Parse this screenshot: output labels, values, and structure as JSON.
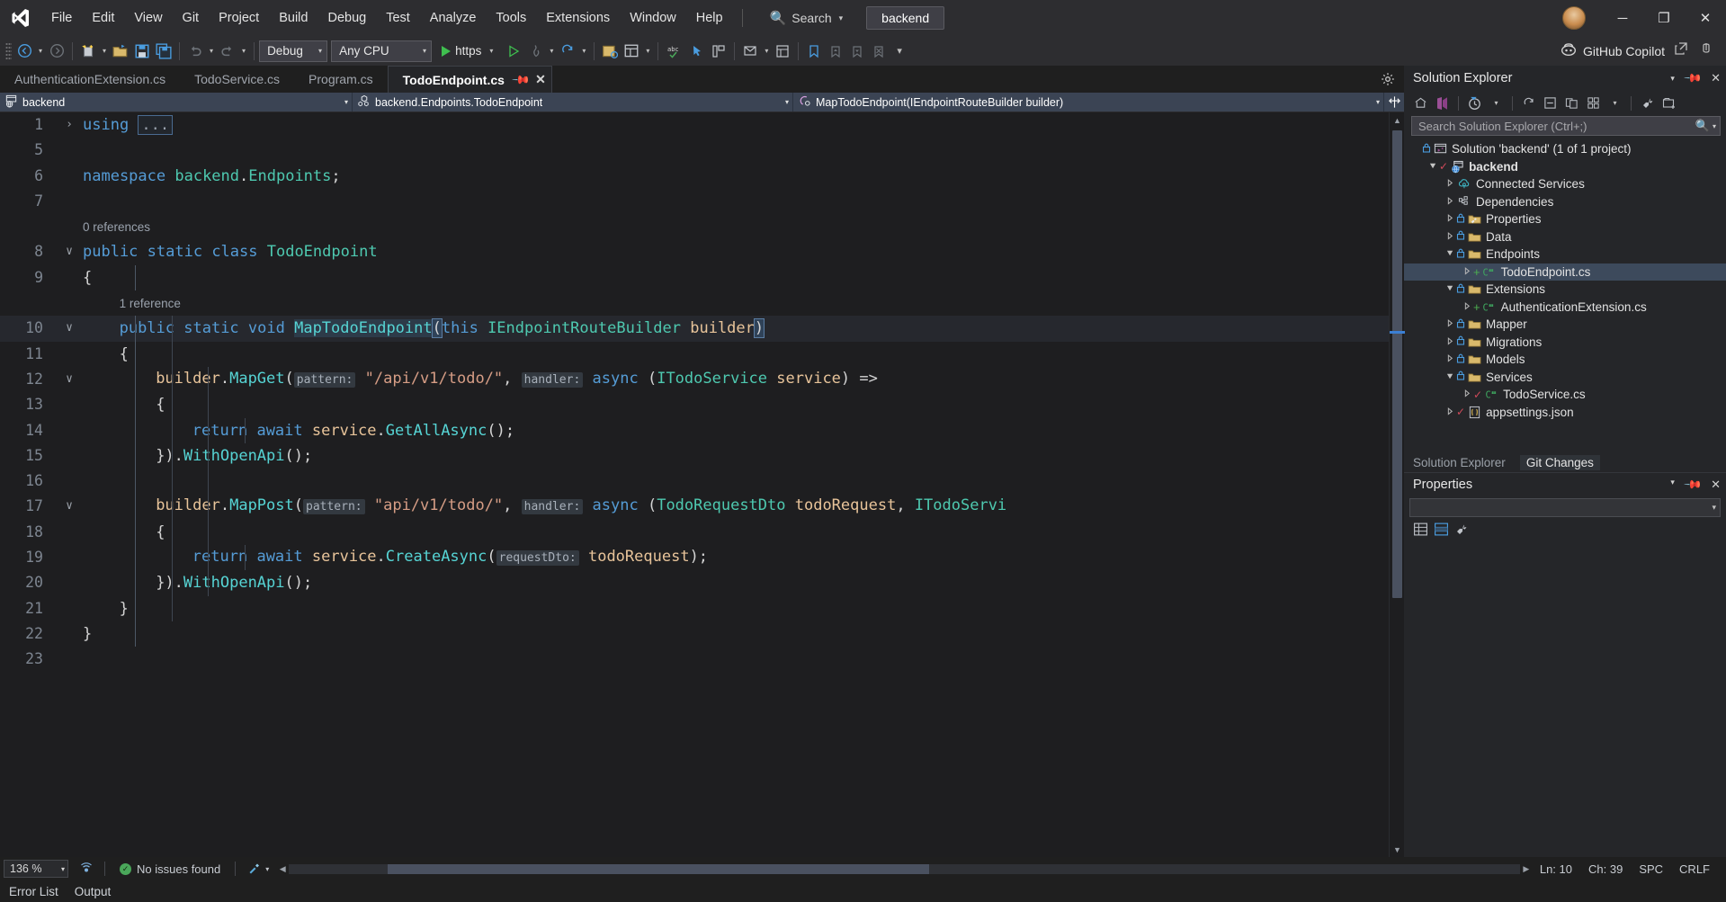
{
  "titlebar": {
    "logo_icon": "visual-studio-logo",
    "menus": [
      "File",
      "Edit",
      "View",
      "Git",
      "Project",
      "Build",
      "Debug",
      "Test",
      "Analyze",
      "Tools",
      "Extensions",
      "Window",
      "Help"
    ],
    "search": {
      "label": "Search",
      "icon": "search-icon",
      "caret": "▾"
    },
    "solution_name": "backend",
    "avatar_icon": "user-avatar",
    "window_buttons": {
      "minimize": "─",
      "maximize": "❐",
      "close": "✕"
    }
  },
  "toolbar": {
    "nav_back_icon": "navigate-back-icon",
    "nav_fwd_icon": "navigate-forward-icon",
    "new_project_icon": "new-project-icon",
    "open_folder_icon": "open-folder-icon",
    "save_icon": "save-icon",
    "save_all_icon": "save-all-icon",
    "undo_icon": "undo-icon",
    "redo_icon": "redo-icon",
    "config_value": "Debug",
    "platform_value": "Any CPU",
    "run_label": "https",
    "run_icon": "start-debug-icon",
    "run_nodebug_icon": "start-without-debugging-icon",
    "hot_reload_icon": "hot-reload-icon",
    "restart_icon": "restart-icon",
    "solution_explorer_icon": "solution-explorer-icon",
    "properties_window_icon": "properties-window-icon",
    "spell_check_icon": "spell-check-icon",
    "pointer_icon": "select-element-icon",
    "layout_icon": "layout-icon",
    "toolbox_icon": "toolbox-icon",
    "notifications_icon": "notifications-icon",
    "bookmark_icon": "bookmark-icon",
    "bookmark_prev_icon": "bookmark-prev-icon",
    "bookmark_next_icon": "bookmark-next-icon",
    "bookmark_clear_icon": "bookmark-clear-icon",
    "overflow_icon": "toolbar-overflow-icon",
    "copilot_label": "GitHub Copilot",
    "copilot_icon": "github-copilot-icon",
    "share_icon": "share-icon",
    "feedback_icon": "feedback-icon"
  },
  "tabs": [
    {
      "label": "AuthenticationExtension.cs",
      "active": false
    },
    {
      "label": "TodoService.cs",
      "active": false
    },
    {
      "label": "Program.cs",
      "active": false
    },
    {
      "label": "TodoEndpoint.cs",
      "active": true,
      "pin_icon": "pin-icon",
      "close_icon": "close-icon"
    }
  ],
  "tabstrip_actions": {
    "dropdown_icon": "tab-list-dropdown-icon",
    "settings_icon": "gear-icon"
  },
  "breadcrumb": {
    "project": "backend",
    "project_icon": "project-web-icon",
    "type": "backend.Endpoints.TodoEndpoint",
    "type_icon": "class-icon",
    "member": "MapTodoEndpoint(IEndpointRouteBuilder builder)",
    "member_icon": "method-icon",
    "split_icon": "split-view-icon",
    "caret": "▾"
  },
  "editor": {
    "lines": [
      {
        "num": "1",
        "glyph": "›",
        "highlight": false,
        "indent": 0,
        "tokens": [
          {
            "t": "using ",
            "c": "k"
          },
          {
            "t": "...",
            "c": "collapse"
          }
        ]
      },
      {
        "num": "5",
        "glyph": "",
        "highlight": false,
        "indent": 0,
        "tokens": []
      },
      {
        "num": "6",
        "glyph": "",
        "highlight": false,
        "indent": 0,
        "tokens": [
          {
            "t": "namespace ",
            "c": "k"
          },
          {
            "t": "backend",
            "c": "kc"
          },
          {
            "t": ".",
            "c": "pn"
          },
          {
            "t": "Endpoints",
            "c": "kc"
          },
          {
            "t": ";",
            "c": "pn"
          }
        ]
      },
      {
        "num": "7",
        "glyph": "",
        "highlight": false,
        "indent": 0,
        "tokens": []
      },
      {
        "ref": "0 references"
      },
      {
        "num": "8",
        "glyph": "∨",
        "highlight": false,
        "indent": 0,
        "tokens": [
          {
            "t": "public ",
            "c": "k"
          },
          {
            "t": "static ",
            "c": "k"
          },
          {
            "t": "class ",
            "c": "k"
          },
          {
            "t": "TodoEndpoint",
            "c": "kc"
          }
        ]
      },
      {
        "num": "9",
        "glyph": "",
        "highlight": false,
        "indent": 0,
        "guides": 1,
        "tokens": [
          {
            "t": "{",
            "c": "pn"
          }
        ]
      },
      {
        "ref": "1 reference",
        "guides": 1,
        "refindent": 1
      },
      {
        "num": "10",
        "glyph": "∨",
        "highlight": true,
        "indent": 1,
        "guides": 2,
        "tokens": [
          {
            "t": "public ",
            "c": "k"
          },
          {
            "t": "static ",
            "c": "k"
          },
          {
            "t": "void ",
            "c": "k"
          },
          {
            "t": "MapTodoEndpoint",
            "c": "selword-mth"
          },
          {
            "t": "(",
            "c": "braceblue"
          },
          {
            "t": "this ",
            "c": "k"
          },
          {
            "t": "IEndpointRouteBuilder ",
            "c": "kc"
          },
          {
            "t": "builder",
            "c": "par"
          },
          {
            "t": ")",
            "c": "braceblue"
          }
        ]
      },
      {
        "num": "11",
        "glyph": "",
        "highlight": false,
        "indent": 1,
        "guides": 2,
        "tokens": [
          {
            "t": "{",
            "c": "pn"
          }
        ]
      },
      {
        "num": "12",
        "glyph": "∨",
        "highlight": false,
        "indent": 2,
        "guides": 3,
        "tokens": [
          {
            "t": "builder",
            "c": "par"
          },
          {
            "t": ".",
            "c": "pn"
          },
          {
            "t": "MapGet",
            "c": "mth"
          },
          {
            "t": "(",
            "c": "pn"
          },
          {
            "t": "pattern:",
            "c": "hint"
          },
          {
            "t": " ",
            "c": "pn"
          },
          {
            "t": "\"/api/v1/todo/\"",
            "c": "str"
          },
          {
            "t": ", ",
            "c": "pn"
          },
          {
            "t": "handler:",
            "c": "hint"
          },
          {
            "t": " ",
            "c": "pn"
          },
          {
            "t": "async ",
            "c": "k"
          },
          {
            "t": "(",
            "c": "pn"
          },
          {
            "t": "ITodoService ",
            "c": "kc"
          },
          {
            "t": "service",
            "c": "par"
          },
          {
            "t": ") =>",
            "c": "pn"
          }
        ]
      },
      {
        "num": "13",
        "glyph": "",
        "highlight": false,
        "indent": 2,
        "guides": 3,
        "tokens": [
          {
            "t": "{",
            "c": "pn"
          }
        ]
      },
      {
        "num": "14",
        "glyph": "",
        "highlight": false,
        "indent": 3,
        "guides": 4,
        "tokens": [
          {
            "t": "return ",
            "c": "k"
          },
          {
            "t": "await ",
            "c": "k"
          },
          {
            "t": "service",
            "c": "par"
          },
          {
            "t": ".",
            "c": "pn"
          },
          {
            "t": "GetAllAsync",
            "c": "mth"
          },
          {
            "t": "();",
            "c": "pn"
          }
        ]
      },
      {
        "num": "15",
        "glyph": "",
        "highlight": false,
        "indent": 2,
        "guides": 3,
        "tokens": [
          {
            "t": "})",
            "c": "pn"
          },
          {
            "t": ".",
            "c": "pn"
          },
          {
            "t": "WithOpenApi",
            "c": "mth"
          },
          {
            "t": "();",
            "c": "pn"
          }
        ]
      },
      {
        "num": "16",
        "glyph": "",
        "highlight": false,
        "indent": 2,
        "guides": 3,
        "tokens": []
      },
      {
        "num": "17",
        "glyph": "∨",
        "highlight": false,
        "indent": 2,
        "guides": 3,
        "tokens": [
          {
            "t": "builder",
            "c": "par"
          },
          {
            "t": ".",
            "c": "pn"
          },
          {
            "t": "MapPost",
            "c": "mth"
          },
          {
            "t": "(",
            "c": "pn"
          },
          {
            "t": "pattern:",
            "c": "hint"
          },
          {
            "t": " ",
            "c": "pn"
          },
          {
            "t": "\"api/v1/todo/\"",
            "c": "str"
          },
          {
            "t": ", ",
            "c": "pn"
          },
          {
            "t": "handler:",
            "c": "hint"
          },
          {
            "t": " ",
            "c": "pn"
          },
          {
            "t": "async ",
            "c": "k"
          },
          {
            "t": "(",
            "c": "pn"
          },
          {
            "t": "TodoRequestDto ",
            "c": "kc"
          },
          {
            "t": "todoRequest",
            "c": "par"
          },
          {
            "t": ", ",
            "c": "pn"
          },
          {
            "t": "ITodoServi",
            "c": "kc"
          }
        ]
      },
      {
        "num": "18",
        "glyph": "",
        "highlight": false,
        "indent": 2,
        "guides": 3,
        "tokens": [
          {
            "t": "{",
            "c": "pn"
          }
        ]
      },
      {
        "num": "19",
        "glyph": "",
        "highlight": false,
        "indent": 3,
        "guides": 4,
        "tokens": [
          {
            "t": "return ",
            "c": "k"
          },
          {
            "t": "await ",
            "c": "k"
          },
          {
            "t": "service",
            "c": "par"
          },
          {
            "t": ".",
            "c": "pn"
          },
          {
            "t": "CreateAsync",
            "c": "mth"
          },
          {
            "t": "(",
            "c": "pn"
          },
          {
            "t": "requestDto:",
            "c": "hint"
          },
          {
            "t": " ",
            "c": "pn"
          },
          {
            "t": "todoRequest",
            "c": "par"
          },
          {
            "t": ");",
            "c": "pn"
          }
        ]
      },
      {
        "num": "20",
        "glyph": "",
        "highlight": false,
        "indent": 2,
        "guides": 3,
        "tokens": [
          {
            "t": "})",
            "c": "pn"
          },
          {
            "t": ".",
            "c": "pn"
          },
          {
            "t": "WithOpenApi",
            "c": "mth"
          },
          {
            "t": "();",
            "c": "pn"
          }
        ]
      },
      {
        "num": "21",
        "glyph": "",
        "highlight": false,
        "indent": 1,
        "guides": 2,
        "tokens": [
          {
            "t": "}",
            "c": "pn"
          }
        ]
      },
      {
        "num": "22",
        "glyph": "",
        "highlight": false,
        "indent": 0,
        "guides": 1,
        "tokens": [
          {
            "t": "}",
            "c": "pn"
          }
        ]
      },
      {
        "num": "23",
        "glyph": "",
        "highlight": false,
        "indent": 0,
        "tokens": []
      }
    ]
  },
  "solution_explorer": {
    "title": "Solution Explorer",
    "actions": {
      "dropdown_icon": "chevron-down-icon",
      "pin_icon": "pin-icon",
      "close_icon": "close-icon"
    },
    "toolbar_icons": [
      "home-icon",
      "sync-icon",
      "collapse-all-icon",
      "show-all-files-icon",
      "refresh-icon",
      "properties-icon",
      "pending-changes-icon",
      "view-code-icon",
      "new-folder-icon"
    ],
    "search_placeholder": "Search Solution Explorer (Ctrl+;)",
    "search_icon": "search-icon",
    "search_caret": "▾",
    "tree": [
      {
        "label": "Solution 'backend' (1 of 1 project)",
        "depth": 0,
        "arrow": "",
        "icon": "solution-icon",
        "lock": true,
        "bold": false
      },
      {
        "label": "backend",
        "depth": 1,
        "arrow": "open",
        "icon": "web-project-icon",
        "check": true,
        "bold": true
      },
      {
        "label": "Connected Services",
        "depth": 2,
        "arrow": "closed",
        "icon": "connected-services-icon"
      },
      {
        "label": "Dependencies",
        "depth": 2,
        "arrow": "closed",
        "icon": "dependencies-icon"
      },
      {
        "label": "Properties",
        "depth": 2,
        "arrow": "closed",
        "icon": "properties-folder-icon",
        "lock": true
      },
      {
        "label": "Data",
        "depth": 2,
        "arrow": "closed",
        "icon": "folder-icon",
        "lock": true
      },
      {
        "label": "Endpoints",
        "depth": 2,
        "arrow": "open",
        "icon": "folder-icon",
        "lock": true
      },
      {
        "label": "TodoEndpoint.cs",
        "depth": 3,
        "arrow": "closed",
        "icon": "csharp-file-icon",
        "plus": true,
        "selected": true
      },
      {
        "label": "Extensions",
        "depth": 2,
        "arrow": "open",
        "icon": "folder-icon",
        "lock": true
      },
      {
        "label": "AuthenticationExtension.cs",
        "depth": 3,
        "arrow": "closed",
        "icon": "csharp-file-icon",
        "plus": true
      },
      {
        "label": "Mapper",
        "depth": 2,
        "arrow": "closed",
        "icon": "folder-icon",
        "lock": true
      },
      {
        "label": "Migrations",
        "depth": 2,
        "arrow": "closed",
        "icon": "folder-icon",
        "lock": true
      },
      {
        "label": "Models",
        "depth": 2,
        "arrow": "closed",
        "icon": "folder-icon",
        "lock": true
      },
      {
        "label": "Services",
        "depth": 2,
        "arrow": "open",
        "icon": "folder-icon",
        "lock": true
      },
      {
        "label": "TodoService.cs",
        "depth": 3,
        "arrow": "closed",
        "icon": "csharp-file-icon",
        "check": true
      },
      {
        "label": "appsettings.json",
        "depth": 2,
        "arrow": "closed",
        "icon": "json-file-icon",
        "check": true
      }
    ],
    "dock_tabs": [
      {
        "label": "Solution Explorer",
        "active": false
      },
      {
        "label": "Git Changes",
        "active": true
      }
    ]
  },
  "properties_panel": {
    "title": "Properties",
    "actions": {
      "dropdown_icon": "chevron-down-icon",
      "pin_icon": "pin-icon",
      "close_icon": "close-icon"
    },
    "selector_caret": "▾",
    "toolbar_icons": [
      "categorized-icon",
      "alphabetical-icon",
      "property-pages-icon"
    ]
  },
  "statusbar": {
    "zoom": "136 %",
    "zoom_caret": "▾",
    "broadcast_icon": "broadcast-icon",
    "issues_text": "No issues found",
    "issues_icon": "ok-check-icon",
    "brush_icon": "intellicode-icon",
    "brush_caret": "▾",
    "line": "Ln: 10",
    "col": "Ch: 39",
    "spaces": "SPC",
    "eol": "CRLF"
  },
  "bottom_dock": {
    "tabs": [
      "Error List",
      "Output"
    ]
  }
}
